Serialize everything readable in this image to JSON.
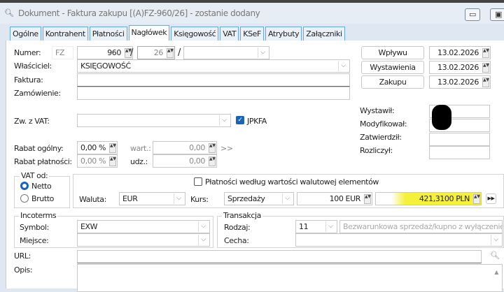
{
  "window": {
    "title": "Dokument - Faktura zakupu [(A)FZ-960/26]  - zostanie dodany",
    "minimize": "▭",
    "maximize": "▣"
  },
  "tabs": [
    "Ogólne",
    "Kontrahent",
    "Płatności",
    "Nagłówek",
    "Księgowość",
    "VAT",
    "KSeF",
    "Atrybuty",
    "Załączniki"
  ],
  "active_tab": "Nagłówek",
  "header": {
    "numer_label": "Numer:",
    "numer_prefix": "FZ",
    "numer": "960",
    "rok": "26",
    "slash": "/",
    "seria": "",
    "wlasciciel_label": "Właściciel:",
    "wlasciciel": "KSIĘGOWOŚĆ",
    "faktura_label": "Faktura:",
    "faktura": "",
    "zamowienie_label": "Zamówienie:",
    "zamowienie": "",
    "zwvat_label": "Zw. z VAT:",
    "zwvat": "",
    "jpkfa_label": "JPKFA",
    "jpkfa_checked": true,
    "rabat_ogolny_label": "Rabat ogólny:",
    "rabat_ogolny": "0,00 %",
    "wart_label": "wart.:",
    "wart": "0,00",
    "arrow_btn": ">>",
    "rabat_platnosci_label": "Rabat płatności:",
    "rabat_platnosci": "0,00 %",
    "udz_label": "udz.:",
    "udz": "0,00"
  },
  "dates": [
    {
      "label": "Wpływu",
      "value": "13.02.2026"
    },
    {
      "label": "Wystawienia",
      "value": "13.02.2026"
    },
    {
      "label": "Zakupu",
      "value": "13.02.2026"
    }
  ],
  "people": [
    {
      "label": "Wystawił:",
      "value": ""
    },
    {
      "label": "Modyfikował:",
      "value": ""
    },
    {
      "label": "Zatwierdził:",
      "value": ""
    },
    {
      "label": "Rozliczył:",
      "value": ""
    }
  ],
  "vat_od": {
    "label": "VAT od:",
    "netto": "Netto",
    "brutto": "Brutto",
    "selected": "Netto"
  },
  "waluta": {
    "platnosci_label": "Płatności według wartości walutowej elementów",
    "platnosci_checked": false,
    "waluta_label": "Waluta:",
    "waluta": "EUR",
    "kurs_label": "Kurs:",
    "kurs": "Sprzedaży",
    "ilosc": "100 EUR",
    "wartosc": "421,3100 PLN",
    "next": "▶▶",
    "highlight": "#f5f03a"
  },
  "incoterms": {
    "label": "Incoterms",
    "symbol_label": "Symbol:",
    "symbol": "EXW",
    "miejsce_label": "Miejsce:",
    "miejsce": ""
  },
  "transakcja": {
    "label": "Transakcja",
    "rodzaj_label": "Rodzaj:",
    "rodzaj": "11",
    "rodzaj_opis": "Bezwarunkowa sprzedaż/kupno z wyłączenier",
    "cecha_label": "Cecha:",
    "cecha": ""
  },
  "url": {
    "label": "URL:",
    "value": ""
  },
  "opis": {
    "label": "Opis:",
    "value": ""
  }
}
